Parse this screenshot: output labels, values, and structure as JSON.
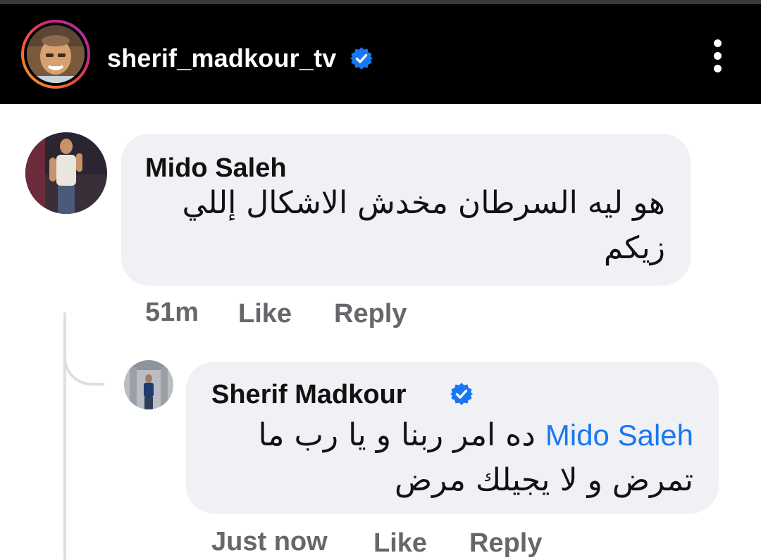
{
  "header": {
    "username": "sherif_madkour_tv",
    "verified_icon": "verified-badge-icon",
    "menu_icon": "more-vertical-icon"
  },
  "comments": [
    {
      "author": "Mido Saleh",
      "text_line1": "هو ليه السرطان مخدش الاشكال إللي",
      "text_line2": "زيكم",
      "time": "51m",
      "like_label": "Like",
      "reply_label": "Reply"
    }
  ],
  "replies": [
    {
      "author": "Sherif Madkour",
      "verified_icon": "verified-badge-icon",
      "mention": "Mido Saleh",
      "text_line1": "ده امر ربنا و يا رب ما",
      "text_line2": "تمرض و لا يجيلك مرض",
      "time": "Just now",
      "like_label": "Like",
      "reply_label": "Reply"
    }
  ],
  "colors": {
    "header_bg": "#000000",
    "bubble_bg": "#eff1f4",
    "mention": "#1877f2",
    "verified": "#1877f2",
    "meta_text": "#65676b"
  }
}
